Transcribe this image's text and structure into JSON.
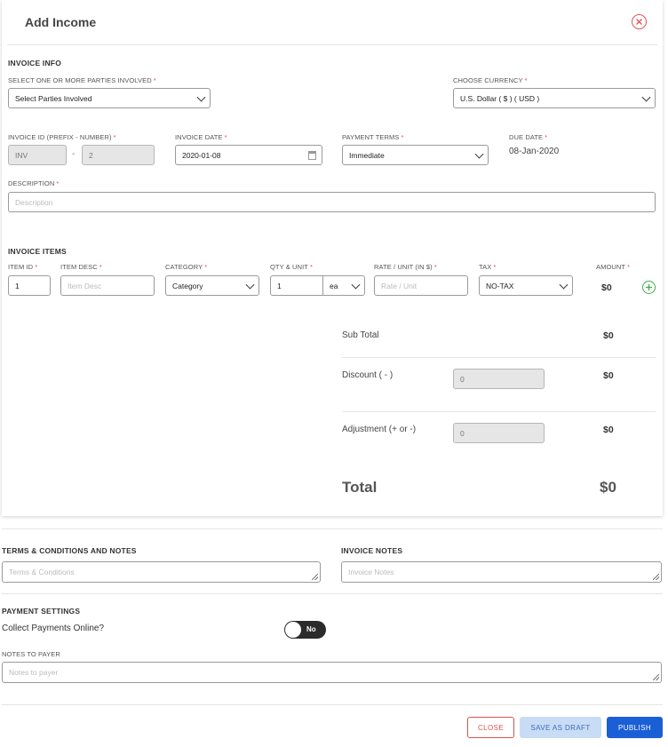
{
  "header": {
    "title": "Add Income"
  },
  "invoice_info": {
    "section_label": "INVOICE INFO",
    "parties_label": "SELECT ONE OR MORE PARTIES INVOLVED",
    "parties_value": "Select Parties Involved",
    "currency_label": "CHOOSE CURRENCY",
    "currency_value": "U.S. Dollar ( $ ) ( USD )",
    "invoice_id_label": "INVOICE ID (PREFIX - NUMBER)",
    "invoice_prefix": "INV",
    "invoice_separator": "-",
    "invoice_number": "2",
    "invoice_date_label": "INVOICE DATE",
    "invoice_date_value": "2020-01-08",
    "payment_terms_label": "PAYMENT TERMS",
    "payment_terms_value": "Immediate",
    "due_date_label": "DUE DATE",
    "due_date_value": "08-Jan-2020",
    "description_label": "DESCRIPTION",
    "description_placeholder": "Description"
  },
  "items": {
    "section_label": "INVOICE ITEMS",
    "headers": {
      "item_id": "ITEM ID",
      "item_desc": "ITEM DESC",
      "category": "CATEGORY",
      "qty_unit": "QTY & UNIT",
      "rate": "RATE / UNIT (IN $)",
      "tax": "TAX",
      "amount": "AMOUNT"
    },
    "row": {
      "item_id": "1",
      "item_desc_placeholder": "Item Desc",
      "category": "Category",
      "qty": "1",
      "unit": "ea",
      "rate_placeholder": "Rate / Unit",
      "tax": "NO-TAX",
      "amount": "$0"
    }
  },
  "totals": {
    "subtotal_label": "Sub Total",
    "subtotal_value": "$0",
    "discount_label": "Discount ( - )",
    "discount_input": "0",
    "discount_value": "$0",
    "adjustment_label": "Adjustment (+ or -)",
    "adjustment_input": "0",
    "adjustment_value": "$0",
    "total_label": "Total",
    "total_value": "$0"
  },
  "notes": {
    "terms_label": "TERMS & CONDITIONS AND NOTES",
    "terms_placeholder": "Terms & Conditions",
    "invoice_notes_label": "INVOICE NOTES",
    "invoice_notes_placeholder": "Invoice Notes"
  },
  "payment_settings": {
    "section_label": "PAYMENT SETTINGS",
    "collect_online_label": "Collect Payments Online?",
    "toggle_label": "No",
    "notes_to_payer_label": "NOTES TO PAYER",
    "notes_to_payer_placeholder": "Notes to payer"
  },
  "actions": {
    "close_label": "CLOSE",
    "draft_label": "SAVE AS DRAFT",
    "publish_label": "PUBLISH"
  },
  "colors": {
    "required": "#d9534f",
    "close_red": "#d9534f",
    "draft_bg": "#c9dcf5",
    "publish_bg": "#1a5fd6",
    "add_green": "#3cb043"
  }
}
